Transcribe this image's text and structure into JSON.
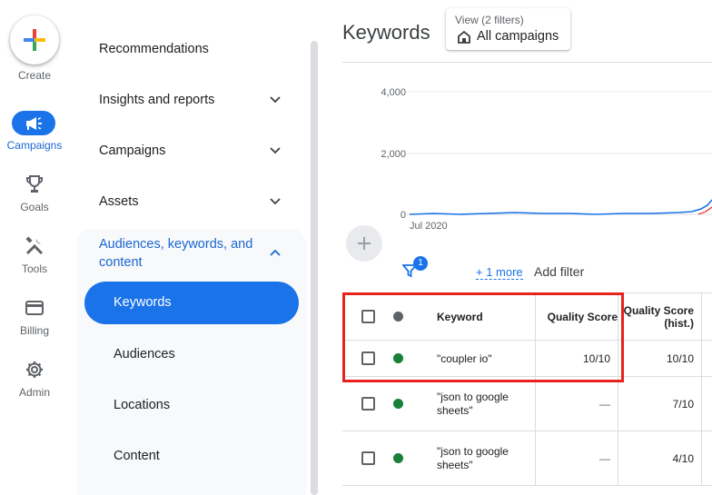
{
  "rail": {
    "create_label": "Create",
    "items": [
      {
        "label": "Campaigns",
        "icon": "megaphone-icon",
        "active": true
      },
      {
        "label": "Goals",
        "icon": "trophy-icon"
      },
      {
        "label": "Tools",
        "icon": "tools-icon"
      },
      {
        "label": "Billing",
        "icon": "credit-card-icon"
      },
      {
        "label": "Admin",
        "icon": "gear-icon"
      }
    ]
  },
  "nav": {
    "items": [
      {
        "label": "Recommendations"
      },
      {
        "label": "Insights and reports",
        "expandable": true
      },
      {
        "label": "Campaigns",
        "expandable": true
      },
      {
        "label": "Assets",
        "expandable": true
      }
    ],
    "expanded_section": {
      "label": "Audiences, keywords, and content",
      "active_item": "Keywords",
      "items": [
        "Audiences",
        "Locations",
        "Content"
      ]
    }
  },
  "main": {
    "title": "Keywords",
    "view": {
      "top": "View (2 filters)",
      "bottom": "All campaigns"
    },
    "chart": {
      "y_ticks": [
        "4,000",
        "2,000",
        "0"
      ],
      "x_tick": "Jul 2020",
      "line_color": "#1a73e8",
      "second_line_color": "#e8221c"
    },
    "filter_bar": {
      "badge_count": "1",
      "more_link": "+ 1 more",
      "add_filter": "Add filter"
    },
    "table": {
      "headers": [
        "Keyword",
        "Quality Score",
        "Quality Score (hist.)"
      ],
      "rows": [
        {
          "keyword": "\"coupler io\"",
          "quality_score": "10/10",
          "quality_score_hist": "10/10",
          "status_color": "#188038"
        },
        {
          "keyword": "\"json to google sheets\"",
          "quality_score": "—",
          "quality_score_hist": "7/10",
          "status_color": "#188038"
        },
        {
          "keyword": "\"json to google sheets\"",
          "quality_score": "—",
          "quality_score_hist": "4/10",
          "status_color": "#188038"
        }
      ]
    }
  },
  "colors": {
    "accent": "#1a73e8",
    "highlight": "#e8221c",
    "enabled_status": "#188038",
    "header_status": "#5f6368"
  }
}
